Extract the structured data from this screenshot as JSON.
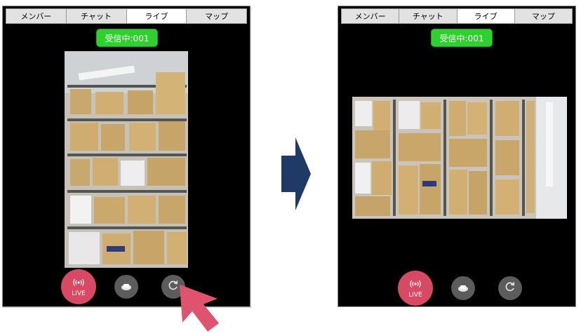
{
  "tabs": [
    "メンバー",
    "チャット",
    "ライブ",
    "マップ"
  ],
  "active_tab_index": 2,
  "status_text": "受信中:001",
  "controls": {
    "live_label": "LIVE",
    "live_icon": "broadcast-icon",
    "camera_icon": "camera-switch-icon",
    "rotate_icon": "rotate-icon"
  },
  "colors": {
    "status_green": "#2ed12e",
    "live_red": "#d84a64",
    "arrow_blue": "#1f3a66",
    "cursor_pink": "#e0536f"
  },
  "left_panel": {
    "video_orientation": "portrait"
  },
  "right_panel": {
    "video_orientation": "landscape"
  }
}
